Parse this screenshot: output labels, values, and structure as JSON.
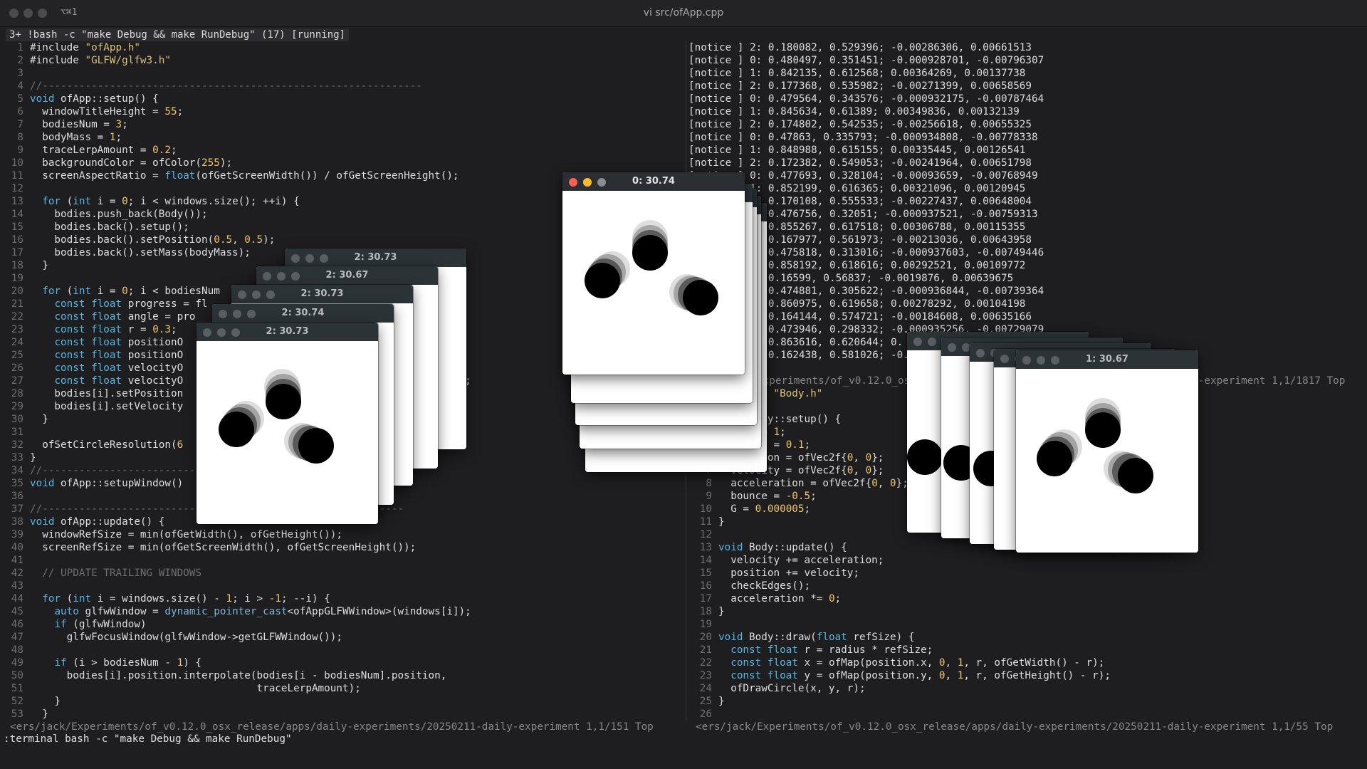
{
  "window": {
    "title": "vi src/ofApp.cpp",
    "tab_shortcut": "⌥⌘1"
  },
  "tabline": "3+ !bash -c \"make Debug && make RunDebug\" (17) [running]",
  "left_code": [
    "#include \"ofApp.h\"",
    "#include \"GLFW/glfw3.h\"",
    "",
    "//--------------------------------------------------------------",
    "void ofApp::setup() {",
    "  windowTitleHeight = 55;",
    "  bodiesNum = 3;",
    "  bodyMass = 1;",
    "  traceLerpAmount = 0.2;",
    "  backgroundColor = ofColor(255);",
    "  screenAspectRatio = float(ofGetScreenWidth()) / ofGetScreenHeight();",
    "",
    "  for (int i = 0; i < windows.size(); ++i) {",
    "    bodies.push_back(Body());",
    "    bodies.back().setup();",
    "    bodies.back().setPosition(0.5, 0.5);",
    "    bodies.back().setMass(bodyMass);",
    "  }",
    "",
    "  for (int i = 0; i < bodiesNum",
    "    const float progress = fl",
    "    const float angle = pro",
    "    const float r = 0.3;",
    "    const float positionO",
    "    const float positionO",
    "    const float velocityO",
    "    const float velocityO                                    5, 0.0075);",
    "    bodies[i].setPosition                                     etY);",
    "    bodies[i].setVelocity",
    "  }",
    "",
    "  ofSetCircleResolution(6",
    "}",
    "//-----------------------------------------------------------",
    "void ofApp::setupWindow()",
    "",
    "//-----------------------------------------------------------",
    "void ofApp::update() {",
    "  windowRefSize = min(ofGetWidth(), ofGetHeight());",
    "  screenRefSize = min(ofGetScreenWidth(), ofGetScreenHeight());",
    "",
    "  // UPDATE TRAILING WINDOWS",
    "",
    "  for (int i = windows.size() - 1; i > -1; --i) {",
    "    auto glfwWindow = dynamic_pointer_cast<ofAppGLFWWindow>(windows[i]);",
    "    if (glfwWindow)",
    "      glfwFocusWindow(glfwWindow->getGLFWWindow());",
    "",
    "    if (i > bodiesNum - 1) {",
    "      bodies[i].position.interpolate(bodies[i - bodiesNum].position,",
    "                                     traceLerpAmount);",
    "    }",
    "  }"
  ],
  "log_lines": [
    "[notice ] 2: 0.180082, 0.529396; -0.00286306, 0.00661513",
    "[notice ] 0: 0.480497, 0.351451; -0.000928701, -0.00796307",
    "[notice ] 1: 0.842135, 0.612568; 0.00364269, 0.00137738",
    "[notice ] 2: 0.177368, 0.535982; -0.00271399, 0.00658569",
    "[notice ] 0: 0.479564, 0.343576; -0.000932175, -0.00787464",
    "[notice ] 1: 0.845634, 0.61389; 0.00349836, 0.00132139",
    "[notice ] 2: 0.174802, 0.542535; -0.00256618, 0.00655325",
    "[notice ] 0: 0.47863, 0.335793; -0.000934808, -0.00778338",
    "[notice ] 1: 0.848988, 0.615155; 0.00335445, 0.00126541",
    "[notice ] 2: 0.172382, 0.549053; -0.00241964, 0.00651798",
    "[notice ] 0: 0.477693, 0.328104; -0.00093659, -0.00768949",
    "[notice ] 1: 0.852199, 0.616365; 0.00321096, 0.00120945",
    "[notice ] 2: 0.170108, 0.555533; -0.00227437, 0.00648004",
    "[notice ] 0: 0.476756, 0.32051; -0.000937521, -0.00759313",
    "[notice ] 1: 0.855267, 0.617518; 0.00306788, 0.00115355",
    "[notice ] 2: 0.167977, 0.561973; -0.00213036, 0.00643958",
    "[notice ] 0: 0.475818, 0.313016; -0.000937603, -0.00749446",
    "[notice ] 1: 0.858192, 0.618616; 0.00292521, 0.00109772",
    "[notice ] 2: 0.16599, 0.56837; -0.0019876, 0.00639675",
    "[notice ] 0: 0.474881, 0.305622; -0.000936844, -0.00739364",
    "[notice ] 1: 0.860975, 0.619658; 0.00278292, 0.00104198",
    "[notice ] 2: 0.164144, 0.574721; -0.00184608, 0.00635166",
    "[notice ] 0: 0.473946, 0.298332; -0.000935256, -0.00729079",
    "[notice ] 1: 0.863616, 0.620644; 0.",
    "[notice ] 2: 0.162438, 0.581026; -0."
  ],
  "right_status": "<ers/jack/Experiments/of_v0.12.0_osx_release/apps/daily-experiments/20250211-daily-experiment 1,1/1817 Top",
  "right_code": [
    "#include \"Body.h\"",
    "",
    "void Body::setup() {",
    "  mass = 1;",
    "  radius = 0.1;",
    "  position = ofVec2f{0, 0};",
    "  velocity = ofVec2f{0, 0};",
    "  acceleration = ofVec2f{0, 0};",
    "  bounce = -0.5;",
    "  G = 0.000005;",
    "}",
    "",
    "void Body::update() {",
    "  velocity += acceleration;",
    "  position += velocity;",
    "  checkEdges();",
    "  acceleration *= 0;",
    "}",
    "",
    "void Body::draw(float refSize) {",
    "  const float r = radius * refSize;",
    "  const float x = ofMap(position.x, 0, 1, r, ofGetWidth() - r);",
    "  const float y = ofMap(position.y, 0, 1, r, ofGetHeight() - r);",
    "  ofDrawCircle(x, y, r);",
    "}",
    ""
  ],
  "bottom_status_left": "<ers/jack/Experiments/of_v0.12.0_osx_release/apps/daily-experiments/20250211-daily-experiment 1,1/151 Top",
  "bottom_status_right": "<ers/jack/Experiments/of_v0.12.0_osx_release/apps/daily-experiments/20250211-daily-experiment 1,1/55 Top",
  "cmdline": ":terminal bash -c \"make Debug && make RunDebug\"",
  "of_windows": {
    "left_titles": [
      "2: 30.73",
      "2: 30.67",
      "2: 30.73",
      "2: 30.74",
      "2: 30.73"
    ],
    "center_title": "0: 30.74",
    "right_title": "1: 30.67"
  },
  "colors": {
    "window_close": "#ff5f57",
    "window_min": "#febc2e",
    "window_zoom": "#8a8d90"
  }
}
